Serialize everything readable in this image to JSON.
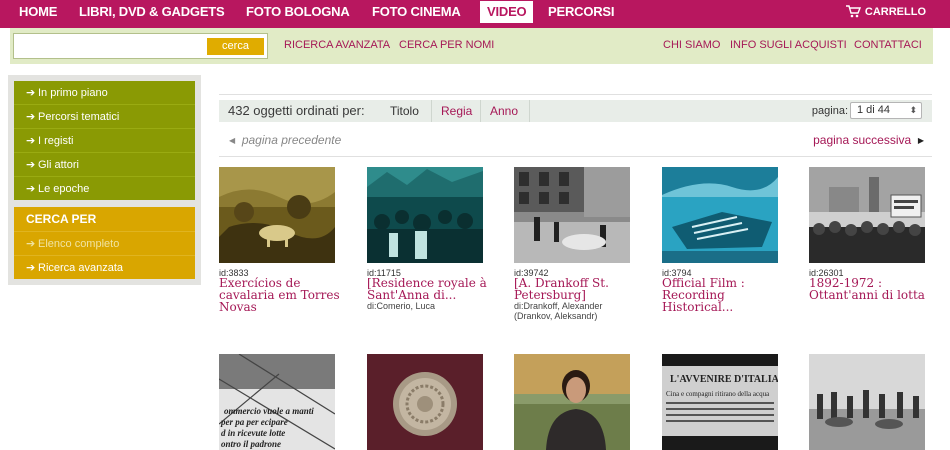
{
  "topnav": {
    "items": [
      "HOME",
      "LIBRI, DVD & GADGETS",
      "FOTO BOLOGNA",
      "FOTO CINEMA",
      "VIDEO",
      "PERCORSI"
    ],
    "active": "VIDEO",
    "cart_label": "CARRELLO",
    "color": "#b8175f"
  },
  "search": {
    "value": "",
    "button": "cerca",
    "links": [
      "RICERCA AVANZATA",
      "CERCA PER NOMI"
    ],
    "right_links": [
      "CHI SIAMO",
      "INFO SUGLI ACQUISTI",
      "CONTATTACI"
    ]
  },
  "sidebar": {
    "nav": [
      "In primo piano",
      "Percorsi tematici",
      "I registi",
      "Gli attori",
      "Le epoche"
    ],
    "cerca_heading": "CERCA PER",
    "cerca_items": [
      "Elenco completo",
      "Ricerca avanzata"
    ],
    "arrow": "➔"
  },
  "results": {
    "count_label": "432 oggetti ordinati per:",
    "sort_options": [
      "Titolo",
      "Regia",
      "Anno"
    ],
    "active_sort": "Titolo",
    "page_label": "pagina:",
    "page_value": "1 di 44",
    "prev_label": "pagina precedente",
    "next_label": "pagina successiva"
  },
  "items": [
    {
      "id": "id:3833",
      "title": "Exercícios de cavalaria em Torres Novas",
      "director": "",
      "icon": "sepia-horse-photo"
    },
    {
      "id": "id:11715",
      "title": "[Residence royale à Sant'Anna di...",
      "director": "di:Comerio, Luca",
      "icon": "cyan-crowd-photo"
    },
    {
      "id": "id:39742",
      "title": "[A. Drankoff St. Petersburg]",
      "director": "di:Drankoff, Alexander (Drankov, Aleksandr)",
      "icon": "bw-street-photo"
    },
    {
      "id": "id:3794",
      "title": "Official Film : Recording Historical...",
      "director": "",
      "icon": "cyan-ship-photo"
    },
    {
      "id": "id:26301",
      "title": "1892-1972 : Ottant'anni di lotta",
      "director": "",
      "icon": "bw-protest-photo"
    },
    {
      "icon": "bw-newspaper-photo",
      "overlay_text": [
        "ommercio vuole a manti",
        "per pa per ecipare",
        "d in ricevute lotte",
        "ontro il padrone"
      ]
    },
    {
      "icon": "coin-photo"
    },
    {
      "icon": "woman-portrait-photo"
    },
    {
      "icon": "newspaper-photo",
      "overlay_text": [
        "L'AVVENIRE D'ITALIA",
        "Cina e compagni ritirano della acqua"
      ]
    },
    {
      "icon": "bw-cavalry-photo"
    }
  ]
}
